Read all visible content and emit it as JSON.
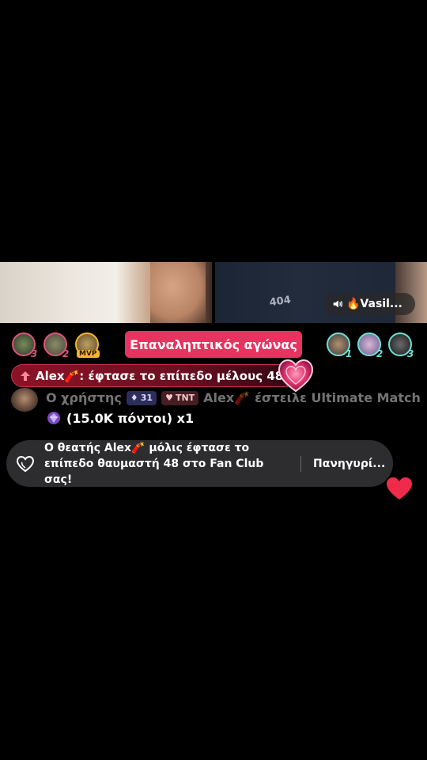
{
  "streamer": {
    "name": "🔥Vasil...",
    "speaker_icon": "speaker-icon"
  },
  "match": {
    "title": "Επαναληπτικός αγώνας"
  },
  "left_ranks": [
    {
      "rank": "3",
      "color": "#e0537a"
    },
    {
      "rank": "2",
      "color": "#e0537a"
    },
    {
      "badge": "MVP"
    }
  ],
  "right_ranks": [
    {
      "rank": "1",
      "color": "#6ee0d8"
    },
    {
      "rank": "2",
      "color": "#6ee0d8"
    },
    {
      "rank": "3",
      "color": "#6ee0d8"
    }
  ],
  "level_banner": {
    "text": "Alex🧨: έφτασε το επίπεδο μέλους 48"
  },
  "gift_message": {
    "user_label": "Ο χρήστης",
    "level_badge": "31",
    "tnt_badge": "TNT",
    "sender": "Alex🧨",
    "action": "έστειλε Ultimate Match",
    "points": "(15.0K πόντοι) x1"
  },
  "notification": {
    "text": "Ο θεατής Alex🧨 μόλις έφτασε το επίπεδο θαυμαστή 48 στο Fan Club σας!",
    "action_label": "Πανηγυρί..."
  },
  "colors": {
    "accent": "#e8325f",
    "team_red": "#e0537a",
    "team_teal": "#6ee0d8",
    "notification_bg": "#2d2d2f"
  }
}
